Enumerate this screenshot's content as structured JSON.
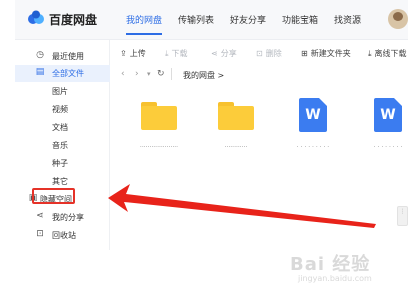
{
  "app": {
    "logo_text": "百度网盘",
    "tabs": [
      {
        "label": "我的网盘",
        "active": true
      },
      {
        "label": "传输列表"
      },
      {
        "label": "好友分享"
      },
      {
        "label": "功能宝箱"
      },
      {
        "label": "找资源"
      }
    ]
  },
  "sidebar": {
    "items": [
      {
        "icon": "clock-icon",
        "label": "最近使用"
      },
      {
        "icon": "file-icon",
        "label": "全部文件",
        "active": true
      },
      {
        "label": "图片"
      },
      {
        "label": "视频"
      },
      {
        "label": "文档"
      },
      {
        "label": "音乐"
      },
      {
        "label": "种子"
      },
      {
        "label": "其它"
      },
      {
        "icon": "lock-icon",
        "label": "隐藏空间",
        "highlighted": true
      },
      {
        "icon": "share-icon",
        "label": "我的分享"
      },
      {
        "icon": "trash-icon",
        "label": "回收站"
      }
    ]
  },
  "toolbar": {
    "upload": "上传",
    "download": "下载",
    "share": "分享",
    "delete": "删除",
    "new_folder": "新建文件夹",
    "offline_download": "离线下载"
  },
  "breadcrumb": {
    "current": "我的网盘",
    "separator": ">"
  },
  "files": [
    {
      "type": "folder",
      "name": "...................."
    },
    {
      "type": "folder",
      "name": "............"
    },
    {
      "type": "word",
      "icon_letter": "W",
      "name": ". . . . . . . . ."
    },
    {
      "type": "word",
      "icon_letter": "W",
      "name": ". . . . . . . ."
    }
  ],
  "watermark": {
    "text": "Bai 经验",
    "sub": "jingyan.baidu.com"
  },
  "colors": {
    "accent": "#2d6de5",
    "highlight": "#e53228",
    "folder": "#fccc3a",
    "word": "#3b7cf0"
  }
}
